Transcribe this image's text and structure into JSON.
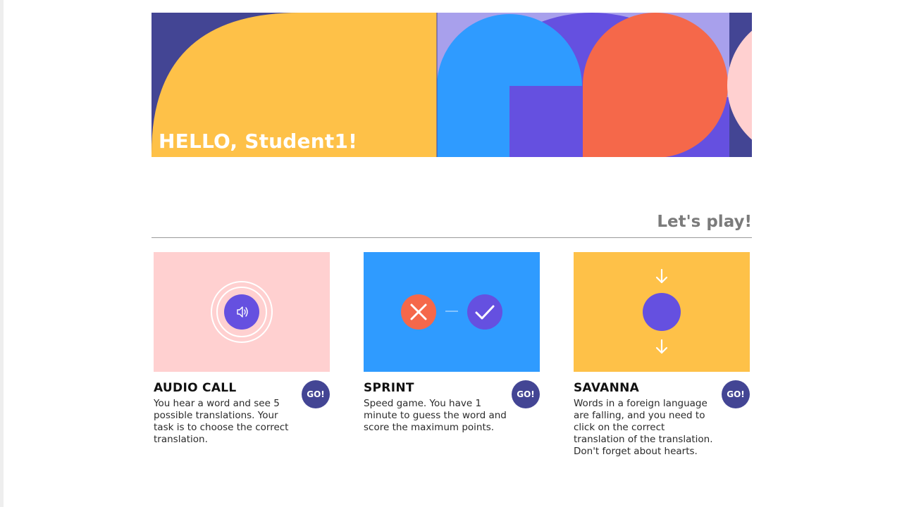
{
  "colors": {
    "navy": "#434594",
    "yellow": "#fec148",
    "blue": "#2f9bff",
    "purple": "#6550e0",
    "lavender": "#a8a0ec",
    "coral": "#f5684a",
    "pink": "#ffd0d0",
    "heading_gray": "#7b7b7b"
  },
  "banner": {
    "greeting": "HELLO, Student1!"
  },
  "section": {
    "title": "Let's play!"
  },
  "games": [
    {
      "title": "AUDIO CALL",
      "description": "You hear a word and see 5 possible translations. Your task is to choose the correct translation.",
      "button_label": "GO!",
      "icon": "speaker-icon",
      "background": "#ffd0d0"
    },
    {
      "title": "SPRINT",
      "description": "Speed game. You have 1 minute to guess the word and score the maximum points.",
      "button_label": "GO!",
      "icon": "cross-check-icon",
      "background": "#2f9bff"
    },
    {
      "title": "SAVANNA",
      "description": "Words in a foreign language are falling, and you need to click on the correct translation of the translation. Don't forget about hearts.",
      "button_label": "GO!",
      "icon": "falling-arrows-icon",
      "background": "#fec148"
    }
  ]
}
